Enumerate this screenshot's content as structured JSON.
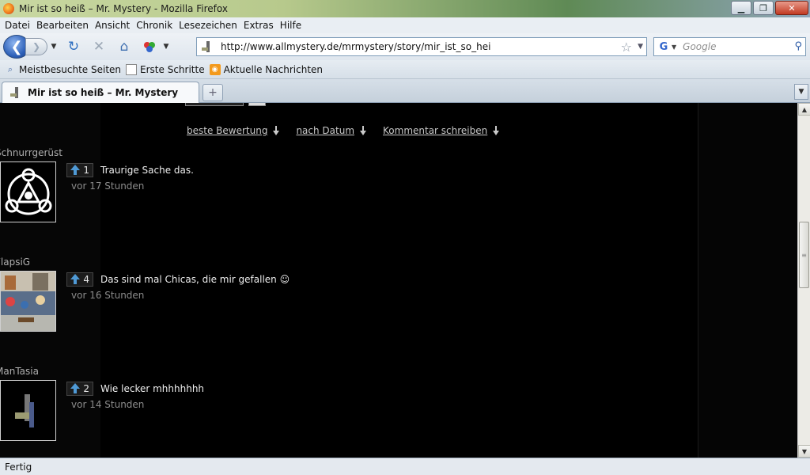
{
  "window": {
    "title": "Mir ist so heiß – Mr. Mystery - Mozilla Firefox"
  },
  "menu": [
    "Datei",
    "Bearbeiten",
    "Ansicht",
    "Chronik",
    "Lesezeichen",
    "Extras",
    "Hilfe"
  ],
  "nav": {
    "url": "http://www.allmystery.de/mrmystery/story/mir_ist_so_hei",
    "search_placeholder": "Google"
  },
  "bookmarks": [
    "Meistbesuchte Seiten",
    "Erste Schritte",
    "Aktuelle Nachrichten"
  ],
  "tab": {
    "title": "Mir ist so heiß – Mr. Mystery"
  },
  "sort": {
    "best": "beste Bewertung",
    "date": "nach Datum",
    "write": "Kommentar schreiben"
  },
  "comments": [
    {
      "user": "Schnurrgerüst",
      "votes": "1",
      "text": "Traurige Sache das.",
      "time": "vor 17 Stunden"
    },
    {
      "user": "FlapsiG",
      "votes": "4",
      "text": "Das sind mal Chicas, die mir gefallen ☺",
      "time": "vor 16 Stunden"
    },
    {
      "user": "ManTasia",
      "votes": "2",
      "text": "Wie lecker mhhhhhhh",
      "time": "vor 14 Stunden"
    }
  ],
  "status": {
    "text": "Fertig"
  }
}
